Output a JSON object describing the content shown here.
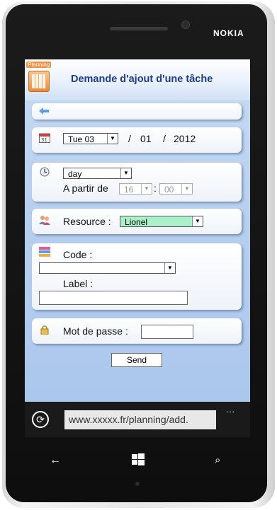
{
  "device": {
    "brand": "NOKIA"
  },
  "header": {
    "logo_text": "Planning",
    "title": "Demande d'ajout d'une tâche"
  },
  "date_row": {
    "day": "Tue 03",
    "sep1": "/",
    "month": "01",
    "sep2": "/",
    "year": "2012"
  },
  "time_row": {
    "period": "day",
    "label": "A partir de",
    "hour": "16",
    "colon": ":",
    "minute": "00"
  },
  "resource_row": {
    "label": "Resource :",
    "value": "Lionel"
  },
  "code_row": {
    "code_label": "Code :",
    "code_value": "",
    "label_label": "Label :",
    "label_value": ""
  },
  "password_row": {
    "label": "Mot de passe :",
    "value": ""
  },
  "send_button": {
    "label": "Send"
  },
  "browser": {
    "url": "www.xxxxx.fr/planning/add.",
    "more": "..."
  },
  "colors": {
    "header_title": "#1d3d88",
    "screen_bg": "#b8d0ef",
    "resource_highlight": "#aaf0c8"
  }
}
